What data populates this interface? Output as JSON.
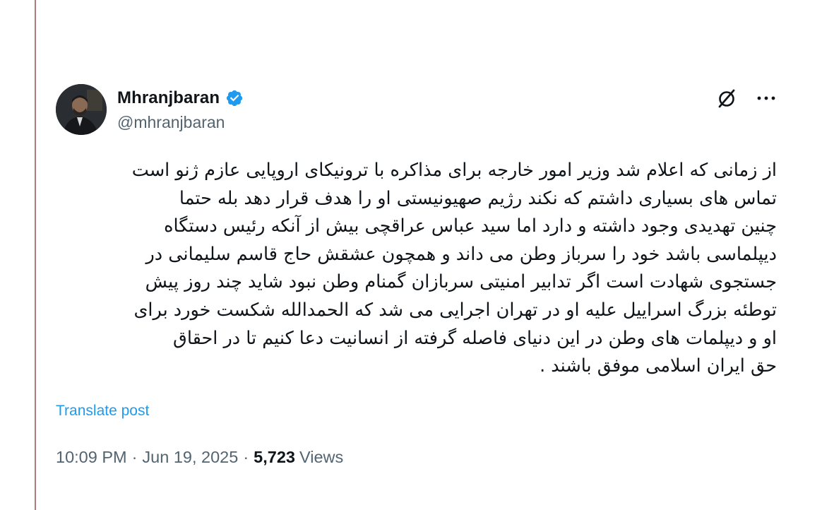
{
  "post": {
    "author": {
      "display_name": "Mhranjbaran",
      "handle": "@mhranjbaran",
      "verified_icon": "verified-badge-icon",
      "badge_color": "#1d9bf0"
    },
    "actions": {
      "grok_icon": "grok-icon",
      "more_icon": "more-options-icon"
    },
    "text_lines": [
      "از زمانی که اعلام شد وزیر امور خارجه برای مذاکره با ترونیکای اروپایی عازم ژنو است",
      "تماس های بسیاری داشتم که نکند رژیم صهیونیستی او را هدف قرار دهد بله حتما",
      "چنین تهدیدی وجود داشته و دارد اما سید عباس عراقچی بیش از آنکه رئیس دستگاه",
      "دیپلماسی باشد خود را سرباز وطن می داند و همچون عشقش حاج قاسم سلیمانی در",
      "جستجوی شهادت است اگر تدابیر امنیتی سربازان گمنام وطن نبود شاید چند روز پیش",
      "توطئه بزرگ اسراییل علیه او در تهران اجرایی می شد که الحمدالله شکست خورد برای",
      "او و دیپلمات های وطن در این دنیای  فاصله گرفته از انسانیت دعا کنیم تا در احقاق",
      "حق ایران اسلامی موفق باشند ."
    ],
    "translate_label": "Translate post",
    "time": "10:09 PM",
    "date": "Jun 19, 2025",
    "separator": "·",
    "views_count": "5,723",
    "views_label": "Views"
  },
  "colors": {
    "accent": "#1d9bf0",
    "secondary_text": "#536471",
    "primary_text": "#0f1419"
  }
}
